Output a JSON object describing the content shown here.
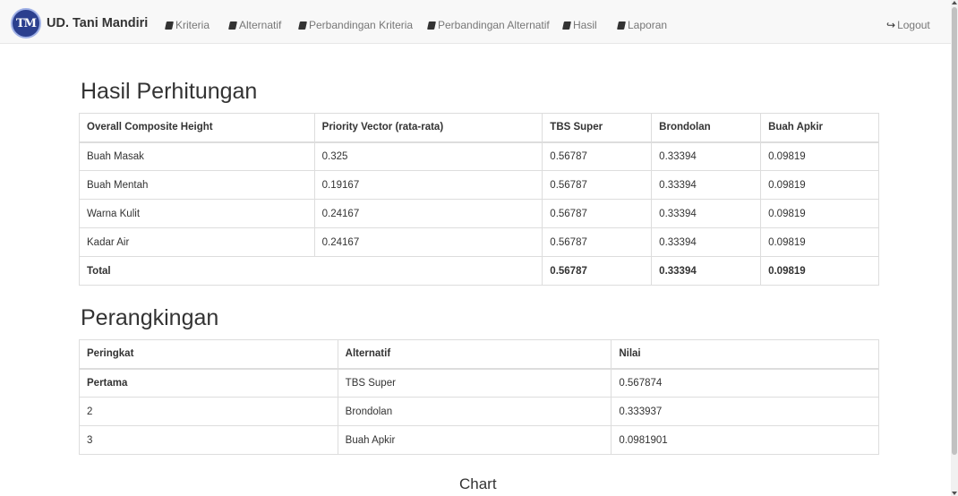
{
  "brand": {
    "logo_text": "TM",
    "name": "UD. Tani Mandiri"
  },
  "nav": {
    "items": [
      "Kriteria",
      "Alternatif",
      "Perbandingan Kriteria",
      "Perbandingan Alternatif",
      "Hasil",
      "Laporan"
    ],
    "logout": "Logout"
  },
  "hasil": {
    "title": "Hasil Perhitungan",
    "headers": [
      "Overall Composite Height",
      "Priority Vector (rata-rata)",
      "TBS Super",
      "Brondolan",
      "Buah Apkir"
    ],
    "rows": [
      [
        "Buah Masak",
        "0.325",
        "0.56787",
        "0.33394",
        "0.09819"
      ],
      [
        "Buah Mentah",
        "0.19167",
        "0.56787",
        "0.33394",
        "0.09819"
      ],
      [
        "Warna Kulit",
        "0.24167",
        "0.56787",
        "0.33394",
        "0.09819"
      ],
      [
        "Kadar Air",
        "0.24167",
        "0.56787",
        "0.33394",
        "0.09819"
      ]
    ],
    "total": [
      "Total",
      "0.56787",
      "0.33394",
      "0.09819"
    ]
  },
  "ranking": {
    "title": "Perangkingan",
    "headers": [
      "Peringkat",
      "Alternatif",
      "Nilai"
    ],
    "rows": [
      [
        "Pertama",
        "TBS Super",
        "0.567874"
      ],
      [
        "2",
        "Brondolan",
        "0.333937"
      ],
      [
        "3",
        "Buah Apkir",
        "0.0981901"
      ]
    ]
  },
  "chart": {
    "title": "Chart"
  }
}
